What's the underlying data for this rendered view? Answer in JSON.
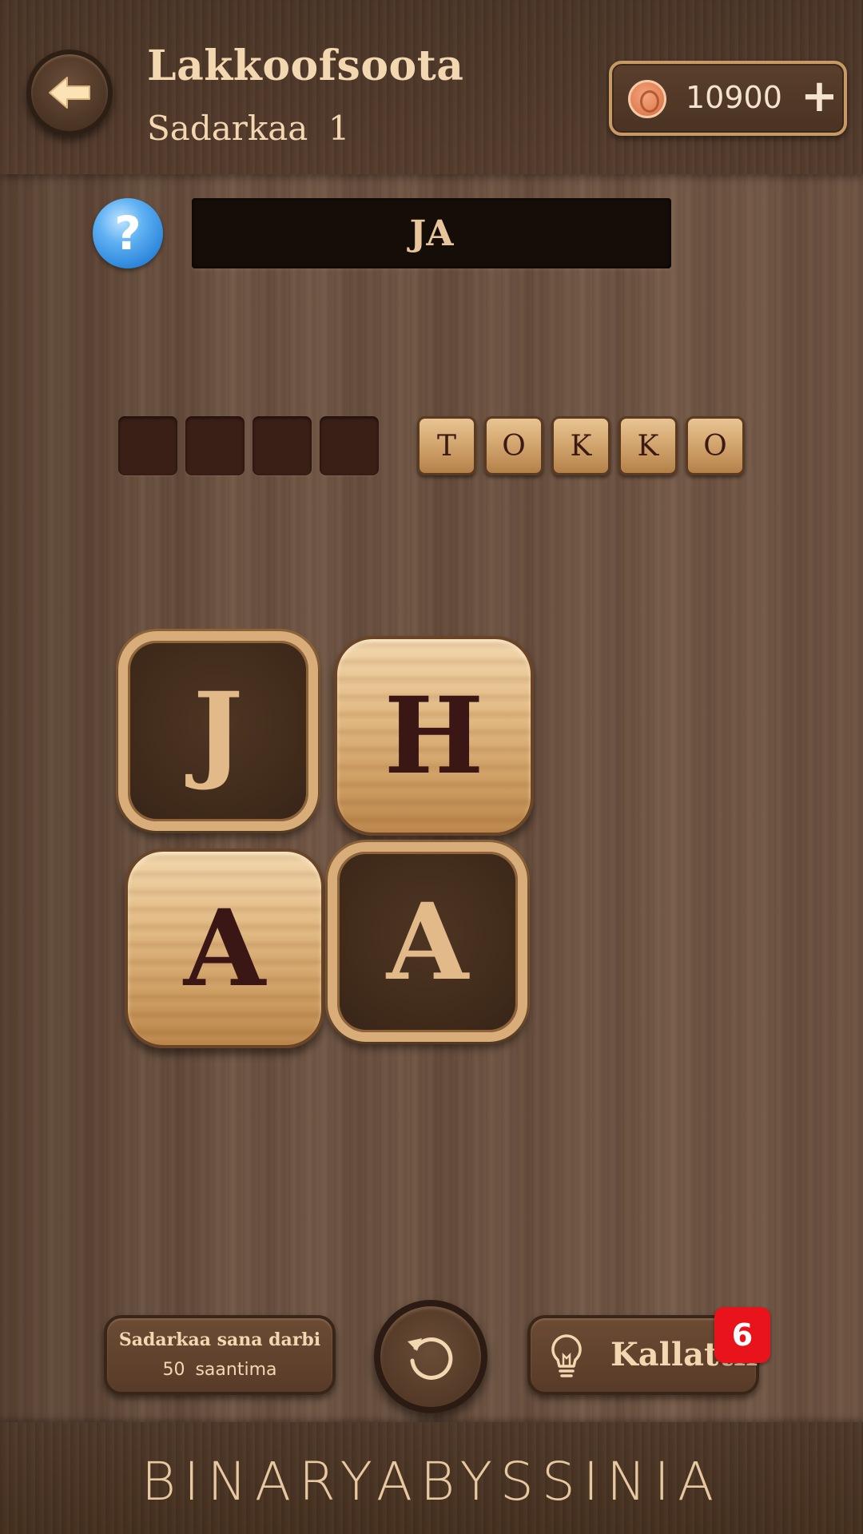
{
  "header": {
    "title": "Lakkoofsoota",
    "level_label": "Sadarkaa 1",
    "coins": "10900",
    "coin_add": "+"
  },
  "clue": {
    "help_symbol": "?",
    "text": "JA"
  },
  "answer_slots": {
    "empty_count": 4,
    "filled": [
      "T",
      "O",
      "K",
      "K",
      "O"
    ]
  },
  "grid": {
    "tiles": [
      {
        "letter": "J",
        "style": "dark"
      },
      {
        "letter": "H",
        "style": "light"
      },
      {
        "letter": "A",
        "style": "light"
      },
      {
        "letter": "A",
        "style": "dark"
      }
    ]
  },
  "controls": {
    "hint_line1": "Sadarkaa sana darbi",
    "hint_line2": "50 saantima",
    "clue_label": "Kallattii",
    "clue_badge": "6"
  },
  "footer": {
    "brand": "BINARYABYSSINIA"
  },
  "colors": {
    "accent_text": "#f3d7b0",
    "badge": "#e8131b",
    "help": "#2c86db"
  }
}
